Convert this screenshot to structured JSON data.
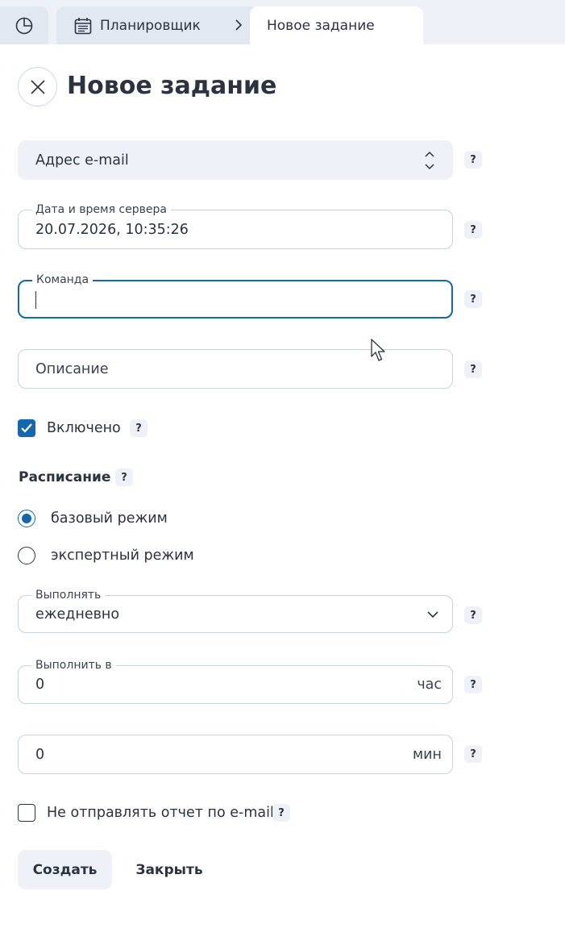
{
  "tabs": {
    "home_icon": "pie-chart-icon",
    "scheduler_icon": "calendar-icon",
    "scheduler_label": "Планировщик",
    "separator_icon": "chevron-right-icon",
    "current_label": "Новое задание"
  },
  "header": {
    "title": "Новое задание",
    "close_icon": "close-icon"
  },
  "form": {
    "type_select": {
      "value": "Адрес e-mail",
      "icon": "up-down-chevron-icon"
    },
    "server_time": {
      "label": "Дата и время сервера",
      "value": "20.07.2026, 10:35:26"
    },
    "command": {
      "label": "Команда",
      "value": ""
    },
    "description": {
      "placeholder": "Описание"
    },
    "enabled": {
      "label": "Включено",
      "checked": true
    },
    "schedule": {
      "title": "Расписание",
      "mode_basic": "базовый режим",
      "mode_expert": "экспертный режим",
      "selected_mode": "базовый режим",
      "run": {
        "label": "Выполнять",
        "value": "ежедневно"
      },
      "run_at": {
        "label": "Выполнить в",
        "value": "0",
        "unit": "час"
      },
      "minutes": {
        "value": "0",
        "unit": "мин"
      }
    },
    "no_email_report": {
      "label": "Не отправлять отчет по e-mail",
      "checked": false
    },
    "help_label": "?"
  },
  "buttons": {
    "create": "Создать",
    "close": "Закрыть"
  },
  "colors": {
    "accent": "#1466ae",
    "tab_bg": "#e1e8f2",
    "soft_bg": "#eef2f8",
    "text": "#2b3340",
    "border": "#c6d3e3"
  }
}
